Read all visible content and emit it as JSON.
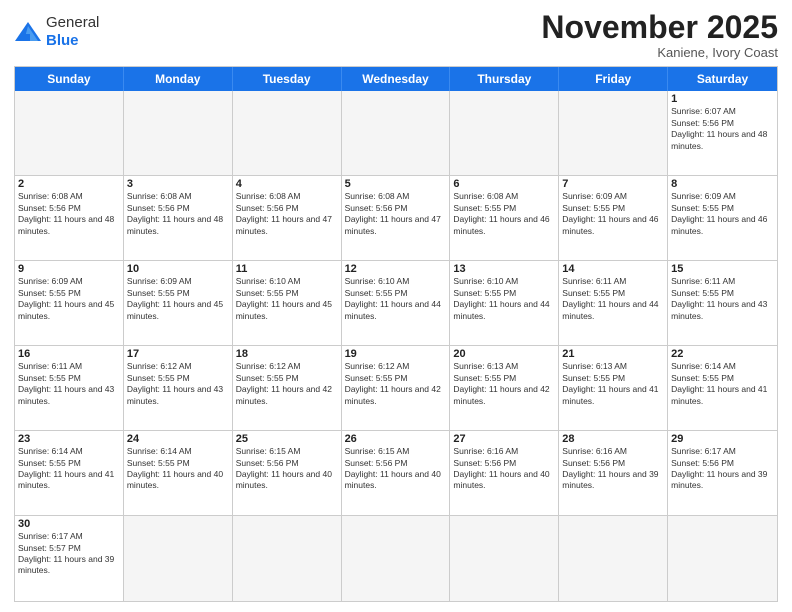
{
  "header": {
    "logo_general": "General",
    "logo_blue": "Blue",
    "month_title": "November 2025",
    "subtitle": "Kaniene, Ivory Coast"
  },
  "day_headers": [
    "Sunday",
    "Monday",
    "Tuesday",
    "Wednesday",
    "Thursday",
    "Friday",
    "Saturday"
  ],
  "cells": [
    {
      "day": "",
      "info": "",
      "empty": true
    },
    {
      "day": "",
      "info": "",
      "empty": true
    },
    {
      "day": "",
      "info": "",
      "empty": true
    },
    {
      "day": "",
      "info": "",
      "empty": true
    },
    {
      "day": "",
      "info": "",
      "empty": true
    },
    {
      "day": "",
      "info": "",
      "empty": true
    },
    {
      "day": "1",
      "info": "Sunrise: 6:07 AM\nSunset: 5:56 PM\nDaylight: 11 hours and 48 minutes.",
      "empty": false
    },
    {
      "day": "2",
      "info": "Sunrise: 6:08 AM\nSunset: 5:56 PM\nDaylight: 11 hours and 48 minutes.",
      "empty": false
    },
    {
      "day": "3",
      "info": "Sunrise: 6:08 AM\nSunset: 5:56 PM\nDaylight: 11 hours and 48 minutes.",
      "empty": false
    },
    {
      "day": "4",
      "info": "Sunrise: 6:08 AM\nSunset: 5:56 PM\nDaylight: 11 hours and 47 minutes.",
      "empty": false
    },
    {
      "day": "5",
      "info": "Sunrise: 6:08 AM\nSunset: 5:56 PM\nDaylight: 11 hours and 47 minutes.",
      "empty": false
    },
    {
      "day": "6",
      "info": "Sunrise: 6:08 AM\nSunset: 5:55 PM\nDaylight: 11 hours and 46 minutes.",
      "empty": false
    },
    {
      "day": "7",
      "info": "Sunrise: 6:09 AM\nSunset: 5:55 PM\nDaylight: 11 hours and 46 minutes.",
      "empty": false
    },
    {
      "day": "8",
      "info": "Sunrise: 6:09 AM\nSunset: 5:55 PM\nDaylight: 11 hours and 46 minutes.",
      "empty": false
    },
    {
      "day": "9",
      "info": "Sunrise: 6:09 AM\nSunset: 5:55 PM\nDaylight: 11 hours and 45 minutes.",
      "empty": false
    },
    {
      "day": "10",
      "info": "Sunrise: 6:09 AM\nSunset: 5:55 PM\nDaylight: 11 hours and 45 minutes.",
      "empty": false
    },
    {
      "day": "11",
      "info": "Sunrise: 6:10 AM\nSunset: 5:55 PM\nDaylight: 11 hours and 45 minutes.",
      "empty": false
    },
    {
      "day": "12",
      "info": "Sunrise: 6:10 AM\nSunset: 5:55 PM\nDaylight: 11 hours and 44 minutes.",
      "empty": false
    },
    {
      "day": "13",
      "info": "Sunrise: 6:10 AM\nSunset: 5:55 PM\nDaylight: 11 hours and 44 minutes.",
      "empty": false
    },
    {
      "day": "14",
      "info": "Sunrise: 6:11 AM\nSunset: 5:55 PM\nDaylight: 11 hours and 44 minutes.",
      "empty": false
    },
    {
      "day": "15",
      "info": "Sunrise: 6:11 AM\nSunset: 5:55 PM\nDaylight: 11 hours and 43 minutes.",
      "empty": false
    },
    {
      "day": "16",
      "info": "Sunrise: 6:11 AM\nSunset: 5:55 PM\nDaylight: 11 hours and 43 minutes.",
      "empty": false
    },
    {
      "day": "17",
      "info": "Sunrise: 6:12 AM\nSunset: 5:55 PM\nDaylight: 11 hours and 43 minutes.",
      "empty": false
    },
    {
      "day": "18",
      "info": "Sunrise: 6:12 AM\nSunset: 5:55 PM\nDaylight: 11 hours and 42 minutes.",
      "empty": false
    },
    {
      "day": "19",
      "info": "Sunrise: 6:12 AM\nSunset: 5:55 PM\nDaylight: 11 hours and 42 minutes.",
      "empty": false
    },
    {
      "day": "20",
      "info": "Sunrise: 6:13 AM\nSunset: 5:55 PM\nDaylight: 11 hours and 42 minutes.",
      "empty": false
    },
    {
      "day": "21",
      "info": "Sunrise: 6:13 AM\nSunset: 5:55 PM\nDaylight: 11 hours and 41 minutes.",
      "empty": false
    },
    {
      "day": "22",
      "info": "Sunrise: 6:14 AM\nSunset: 5:55 PM\nDaylight: 11 hours and 41 minutes.",
      "empty": false
    },
    {
      "day": "23",
      "info": "Sunrise: 6:14 AM\nSunset: 5:55 PM\nDaylight: 11 hours and 41 minutes.",
      "empty": false
    },
    {
      "day": "24",
      "info": "Sunrise: 6:14 AM\nSunset: 5:55 PM\nDaylight: 11 hours and 40 minutes.",
      "empty": false
    },
    {
      "day": "25",
      "info": "Sunrise: 6:15 AM\nSunset: 5:56 PM\nDaylight: 11 hours and 40 minutes.",
      "empty": false
    },
    {
      "day": "26",
      "info": "Sunrise: 6:15 AM\nSunset: 5:56 PM\nDaylight: 11 hours and 40 minutes.",
      "empty": false
    },
    {
      "day": "27",
      "info": "Sunrise: 6:16 AM\nSunset: 5:56 PM\nDaylight: 11 hours and 40 minutes.",
      "empty": false
    },
    {
      "day": "28",
      "info": "Sunrise: 6:16 AM\nSunset: 5:56 PM\nDaylight: 11 hours and 39 minutes.",
      "empty": false
    },
    {
      "day": "29",
      "info": "Sunrise: 6:17 AM\nSunset: 5:56 PM\nDaylight: 11 hours and 39 minutes.",
      "empty": false
    },
    {
      "day": "30",
      "info": "Sunrise: 6:17 AM\nSunset: 5:57 PM\nDaylight: 11 hours and 39 minutes.",
      "empty": false
    },
    {
      "day": "",
      "info": "",
      "empty": true
    },
    {
      "day": "",
      "info": "",
      "empty": true
    },
    {
      "day": "",
      "info": "",
      "empty": true
    },
    {
      "day": "",
      "info": "",
      "empty": true
    },
    {
      "day": "",
      "info": "",
      "empty": true
    },
    {
      "day": "",
      "info": "",
      "empty": true
    }
  ]
}
